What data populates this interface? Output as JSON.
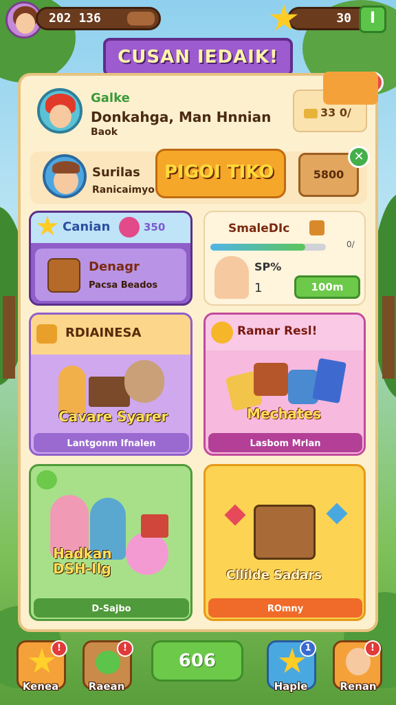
{
  "top_bar": {
    "currency_value": "202 136",
    "stars_value": "30",
    "plus_label": "I"
  },
  "title": "CUSAN IEDAIK!",
  "profile_row": {
    "name": "Galke",
    "subtitle": "Donkahga, Man Hnnian",
    "small": "Baok",
    "right_value": "33 0/"
  },
  "promo_row": {
    "label": "Surilas",
    "sublabel": "Ranicaimyo",
    "logo_text": "PIGOI TIKO",
    "price": "5800"
  },
  "card1": {
    "header": "Canian",
    "header_value": "350",
    "title": "Denagr",
    "subtitle": "Pacsa Beados"
  },
  "card2": {
    "title": "SmaleDIc",
    "progress_fraction": 0.82,
    "percent_label": "0/",
    "stat": "SP%",
    "count": "1",
    "button": "100m"
  },
  "card3": {
    "header": "RDIAINESA",
    "caption": "Cavare Syarer",
    "footer": "Lantgonm Ifnalen"
  },
  "card4": {
    "header": "Ramar Resl!",
    "caption": "Mechates",
    "footer": "Lasbom Mrlan"
  },
  "card5": {
    "caption": "Hadkan DSH-Ilg",
    "footer": "D-Sajbo"
  },
  "card6": {
    "caption": "Cllilde Sadars",
    "footer": "ROmny"
  },
  "bottom_nav": {
    "item1": "Kenea",
    "item2": "Raean",
    "center": "606",
    "item4": "Haple",
    "item5": "Renan",
    "badge1": "!",
    "badge2": "!",
    "badge4": "1",
    "badge5": "!"
  },
  "colors": {
    "panel": "#fdf0cf",
    "accent_purple": "#9d5bd0",
    "accent_green": "#6cc94a",
    "accent_orange": "#f59a2a"
  }
}
